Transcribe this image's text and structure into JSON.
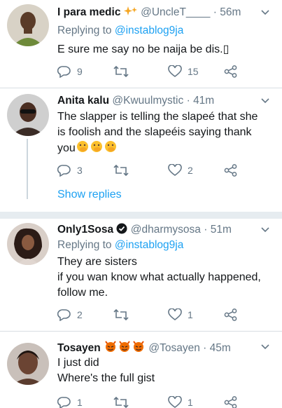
{
  "tweets": [
    {
      "name": "I para medic",
      "name_emoji": "sparkle-badge",
      "handle": "@UncleT____",
      "separator": "·",
      "time": "56m",
      "reply_prefix": "Replying to",
      "reply_to": "@instablog9ja",
      "lines": [
        "E sure me say no be naija be dis.▯"
      ],
      "replies": "9",
      "retweets": "",
      "likes": "15"
    },
    {
      "name": "Anita kalu",
      "handle": "@Kwuulmystic",
      "separator": "·",
      "time": "41m",
      "lines": [
        "The slapper is telling the slapeé that she",
        "is foolish and the slapeéis saying thank",
        "you"
      ],
      "emojis": [
        "face-with-hand-over-mouth",
        "face-with-hand-over-mouth",
        "face-with-hand-over-mouth"
      ],
      "replies": "3",
      "retweets": "",
      "likes": "2",
      "show_replies": "Show replies"
    },
    {
      "name": "Only1Sosa",
      "verified_icon": "verified-badge",
      "handle": "@dharmysosa",
      "separator": "·",
      "time": "51m",
      "reply_prefix": "Replying to",
      "reply_to": "@instablog9ja",
      "lines": [
        "They are sisters",
        "if you wan know what actually happened,",
        "follow me."
      ],
      "replies": "2",
      "retweets": "",
      "likes": "1"
    },
    {
      "name": "Tosayen",
      "name_emojis": [
        "devil-face",
        "devil-face",
        "devil-face"
      ],
      "handle": "@Tosayen",
      "separator": "·",
      "time": "45m",
      "lines": [
        "I just did",
        "Where's the full gist"
      ],
      "replies": "1",
      "retweets": "",
      "likes": "1"
    }
  ],
  "colors": {
    "text": "#14171a",
    "secondary": "#657786",
    "link": "#1da1f2",
    "divider": "#e6ecf0"
  }
}
